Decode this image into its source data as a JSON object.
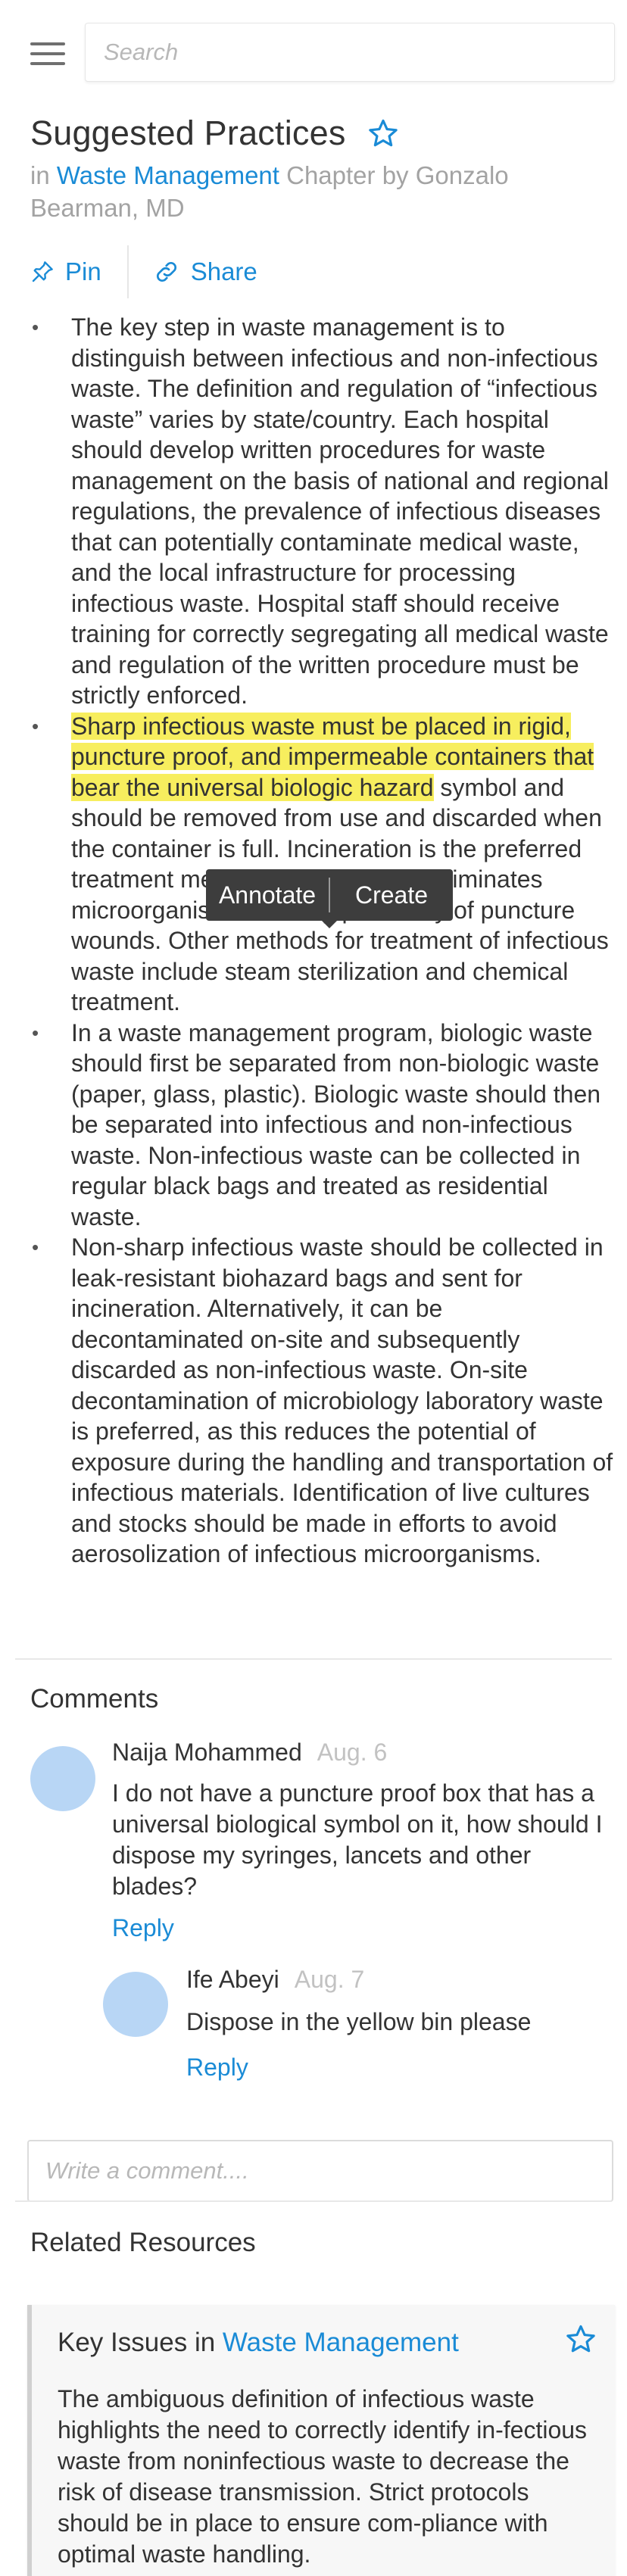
{
  "search": {
    "placeholder": "Search"
  },
  "page": {
    "title": "Suggested Practices",
    "subtitle_prefix": "in",
    "chapter_link": "Waste Management",
    "subtitle_suffix": "Chapter by Gonzalo Bearman, MD"
  },
  "actions": {
    "pin": "Pin",
    "share": "Share"
  },
  "article": {
    "bullets": [
      "The key step in waste management is to distinguish between infectious and non-infectious waste. The definition and regulation of “infectious waste” varies by state/country. Each hospital should develop written procedures for waste management on the basis of national and regional regulations, the prevalence of infectious diseases that can potentially contaminate medical waste, and the local infrastructure for processing infectious waste. Hospital staff should receive training for correctly segregating all medical waste and regulation of the written procedure must be strictly enforced.",
      "",
      "In a waste management program, biologic waste should first be separated from non-biologic waste (paper, glass, plastic). Biologic waste should then be separated into infectious and non-infectious waste. Non-infectious waste can be collected in regular black bags and treated as residential waste.",
      "Non-sharp infectious waste should be collected in leak-resistant biohazard bags and sent for incineration. Alternatively, it can be decontaminated on-site and subsequently discarded as non-infectious waste. On-site decontamination of microbiology laboratory waste is preferred, as this reduces the potential of exposure during the handling and transportation of infectious materials. Identification of live cultures and stocks should be made in efforts to avoid aerosolization of infectious microorganisms."
    ],
    "bullet2_highlight": "Sharp infectious waste must be placed in rigid, puncture proof, and impermeable containers that bear the universal biologic hazard",
    "bullet2_rest": " symbol and should be removed from use and discarded when the container is full. Incineration is the preferred treatment method for sharps as it eliminates microorganisms and any possibility of puncture wounds. Other methods for treatment of infectious waste include steam sterilization and chemical treatment."
  },
  "selection_popup": {
    "annotate": "Annotate",
    "create": "Create"
  },
  "comments": {
    "heading": "Comments",
    "items": [
      {
        "author": "Naija Mohammed",
        "date": "Aug. 6",
        "text": "I do not have a puncture proof box that has a universal biological symbol on it, how should I dispose my syringes, lancets and other blades?",
        "reply": "Reply"
      },
      {
        "author": "Ife Abeyi",
        "date": "Aug. 7",
        "text": "Dispose in the yellow bin please",
        "reply": "Reply"
      }
    ],
    "input_placeholder": "Write a comment...."
  },
  "related": {
    "heading": "Related Resources",
    "card": {
      "title": "Key Issues",
      "in": "in",
      "link": "Waste Management",
      "text": "The ambiguous definition of infectious waste highlights the need to correctly identify in-fectious waste from noninfectious waste to decrease the risk of disease transmission. Strict protocols should be in place to ensure com-pliance with optimal waste handling."
    }
  },
  "colors": {
    "accent": "#1a8bd6",
    "highlight": "#f7ee5e",
    "avatar": "#b8d6f5",
    "muted": "#a3a3a3"
  }
}
